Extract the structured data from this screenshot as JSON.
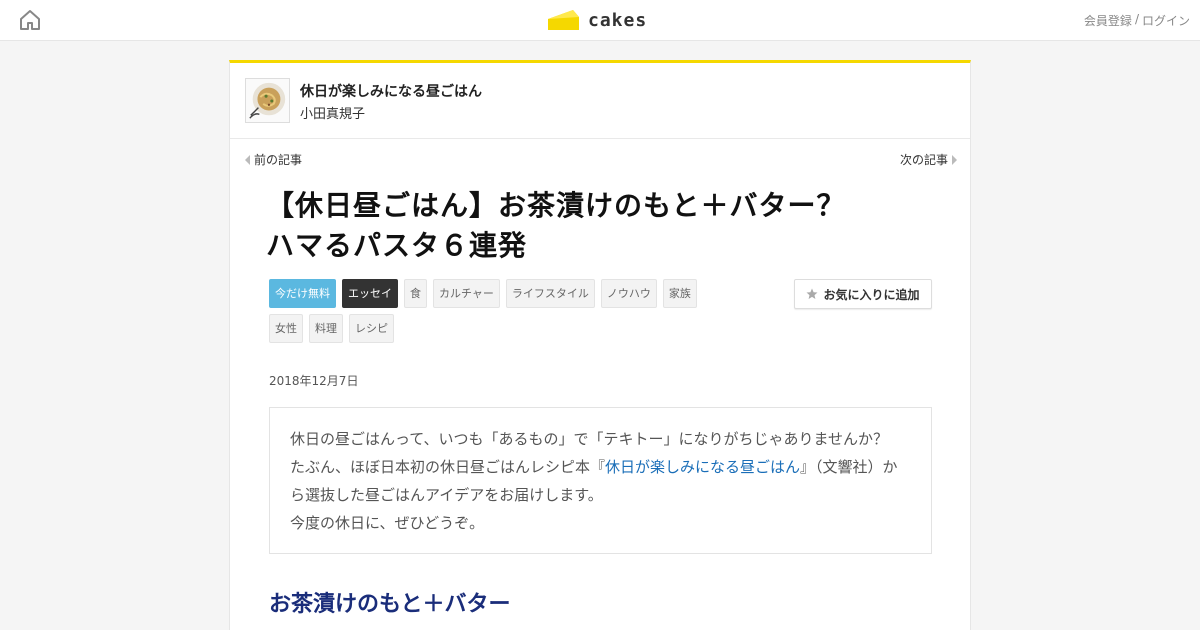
{
  "header": {
    "logo_text": "cakes",
    "register_label": "会員登録",
    "separator": "/",
    "login_label": "ログイン",
    "accent_color": "#f5d800"
  },
  "series": {
    "title": "休日が楽しみになる昼ごはん",
    "author": "小田真規子"
  },
  "nav": {
    "prev_label": "前の記事",
    "next_label": "次の記事"
  },
  "article": {
    "title": "【休日昼ごはん】お茶漬けのもと＋バター？　ハマるパスタ６連発",
    "tags": [
      "今だけ無料",
      "エッセイ",
      "食",
      "カルチャー",
      "ライフスタイル",
      "ノウハウ",
      "家族",
      "女性",
      "料理",
      "レシピ"
    ],
    "favorite_label": "お気に入りに追加",
    "date": "2018年12月7日",
    "lead": {
      "text_before": "休日の昼ごはんって、いつも「あるもの」で「テキトー」になりがちじゃありませんか？　たぶん、ほぼ日本初の休日昼ごはんレシピ本『",
      "book_link": "休日が楽しみになる昼ごはん",
      "text_after": "』（文響社）から選抜した昼ごはんアイデアをお届けします。",
      "line_last": "今度の休日に、ぜひどうぞ。"
    },
    "section_heading": "お茶漬けのもと＋バター"
  }
}
